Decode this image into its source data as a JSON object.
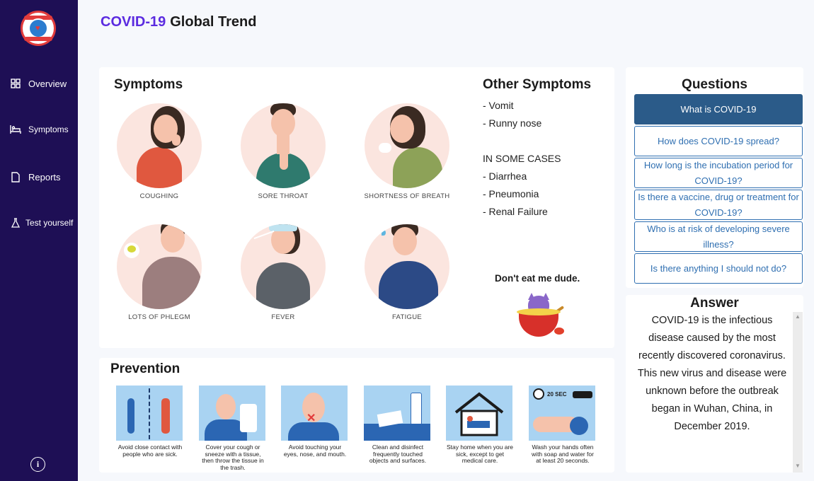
{
  "app": {
    "title_accent": "COVID-19",
    "title_rest": "Global Trend",
    "colors": {
      "sidebar": "#1e0f55",
      "accent": "#5b2be0",
      "question_active": "#2b5b89",
      "question_border": "#2f6fb1"
    }
  },
  "sidebar": {
    "items": [
      {
        "label": "Overview",
        "icon": "grid-icon"
      },
      {
        "label": "Symptoms",
        "icon": "bed-icon"
      },
      {
        "label": "Reports",
        "icon": "document-icon"
      },
      {
        "label": "Test yourself",
        "icon": "flask-icon"
      }
    ],
    "info_icon": "info-icon"
  },
  "symptoms": {
    "title": "Symptoms",
    "items": [
      {
        "label": "COUGHING"
      },
      {
        "label": "SORE THROAT"
      },
      {
        "label": "SHORTNESS OF BREATH"
      },
      {
        "label": "LOTS OF PHLEGM"
      },
      {
        "label": "FEVER"
      },
      {
        "label": "FATIGUE"
      }
    ]
  },
  "other_symptoms": {
    "title": "Other Symptoms",
    "lines": [
      "- Vomit",
      "- Runny nose",
      "IN SOME CASES",
      "- Diarrhea",
      "- Pneumonia",
      "- Renal Failure"
    ]
  },
  "mascot": {
    "caption": "Don't eat me dude."
  },
  "prevention": {
    "title": "Prevention",
    "items": [
      {
        "caption": "Avoid close contact with people who are sick."
      },
      {
        "caption": "Cover your cough or sneeze with a tissue, then throw the tissue in the trash."
      },
      {
        "caption": "Avoid touching your eyes, nose, and mouth."
      },
      {
        "caption": "Clean and disinfect frequently touched objects and surfaces."
      },
      {
        "caption": "Stay home when you are sick, except to get medical care."
      },
      {
        "caption": "Wash your hands often with soap and water for at least 20 seconds."
      }
    ],
    "timer_label": "20 SEC"
  },
  "questions": {
    "title": "Questions",
    "items": [
      {
        "label": "What is COVID-19",
        "active": true
      },
      {
        "label": "How does COVID-19 spread?",
        "active": false
      },
      {
        "label": "How long is the incubation period for COVID-19?",
        "active": false
      },
      {
        "label": "Is there a vaccine, drug or treatment for COVID-19?",
        "active": false
      },
      {
        "label": "Who is at risk of developing severe illness?",
        "active": false
      },
      {
        "label": "Is there anything I should not do?",
        "active": false
      }
    ]
  },
  "answer": {
    "title": "Answer",
    "text": "COVID-19 is the infectious disease caused by the most recently discovered coronavirus. This new virus and disease were unknown before the outbreak began in Wuhan, China, in December 2019."
  }
}
